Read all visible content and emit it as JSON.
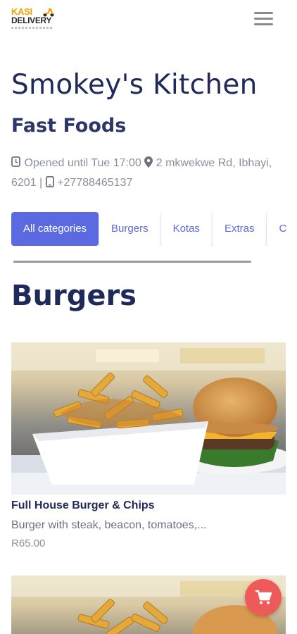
{
  "brand": {
    "logo_line1": "KASI",
    "logo_line2": "DELIVERY",
    "colors": {
      "logo_orange": "#f5a100",
      "logo_dark": "#2a2a2a"
    }
  },
  "header": {
    "menu_icon": "hamburger-menu-icon"
  },
  "restaurant": {
    "name": "Smokey's Kitchen",
    "category": "Fast Foods",
    "hours": "Opened until Tue 17:00",
    "address": "2 mkwekwe Rd, Ibhayi, 6201",
    "separator": "|",
    "phone": "+27788465137"
  },
  "categories": {
    "items": [
      "All categories",
      "Burgers",
      "Kotas",
      "Extras",
      "C"
    ],
    "active_index": 0
  },
  "section": {
    "title": "Burgers"
  },
  "menu_items": [
    {
      "name": "Full House Burger & Chips",
      "description": "Burger with steak, beacon, tomatoes,...",
      "price": "R65.00"
    }
  ],
  "colors": {
    "accent": "#5b6ae0",
    "text_dark": "#1f2a5a",
    "text_muted": "#8a8f9c",
    "cart_button": "#ee5a5a"
  },
  "icons": {
    "clock": "clock-icon",
    "location": "map-pin-icon",
    "phone": "mobile-phone-icon",
    "cart": "shopping-cart-icon"
  }
}
